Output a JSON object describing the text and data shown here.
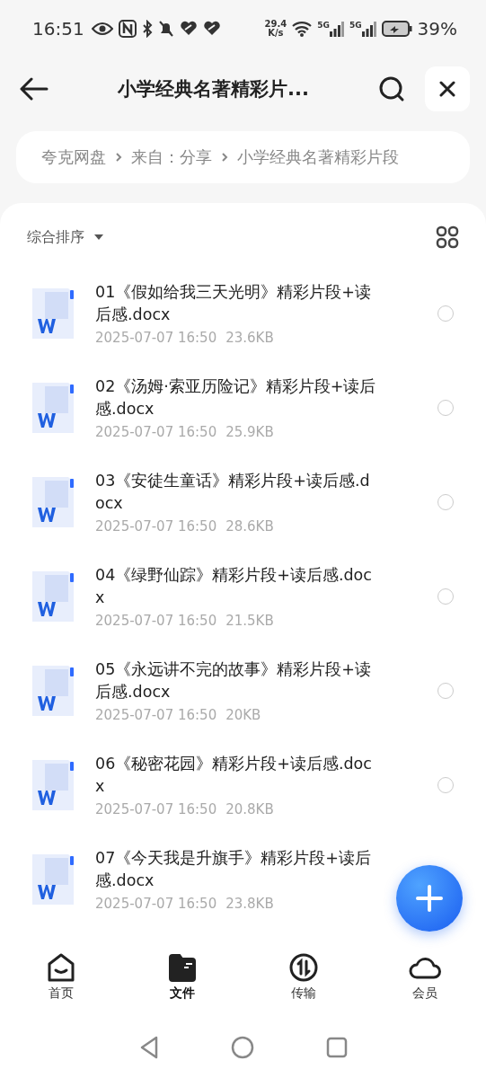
{
  "status_bar": {
    "time": "16:51",
    "net_speed_value": "29.4",
    "net_speed_unit": "K/s",
    "signal_1": "5G",
    "signal_2": "5G",
    "battery": "39%"
  },
  "header": {
    "title": "小学经典名著精彩片..."
  },
  "breadcrumb": [
    "夸克网盘",
    "来自：分享",
    "小学经典名著精彩片段"
  ],
  "sort": {
    "label": "综合排序"
  },
  "files": [
    {
      "name": "01《假如给我三天光明》精彩片段+读后感.docx",
      "date": "2025-07-07 16:50",
      "size": "23.6KB",
      "selected": false
    },
    {
      "name": "02《汤姆·索亚历险记》精彩片段+读后感.docx",
      "date": "2025-07-07 16:50",
      "size": "25.9KB",
      "selected": false
    },
    {
      "name": "03《安徒生童话》精彩片段+读后感.docx",
      "date": "2025-07-07 16:50",
      "size": "28.6KB",
      "selected": false
    },
    {
      "name": "04《绿野仙踪》精彩片段+读后感.docx",
      "date": "2025-07-07 16:50",
      "size": "21.5KB",
      "selected": false
    },
    {
      "name": "05《永远讲不完的故事》精彩片段+读后感.docx",
      "date": "2025-07-07 16:50",
      "size": "20KB",
      "selected": false
    },
    {
      "name": "06《秘密花园》精彩片段+读后感.docx",
      "date": "2025-07-07 16:50",
      "size": "20.8KB",
      "selected": false
    },
    {
      "name": "07《今天我是升旗手》精彩片段+读后感.docx",
      "date": "2025-07-07 16:50",
      "size": "23.8KB"
    }
  ],
  "bottom_nav": [
    {
      "label": "首页",
      "kind": "home",
      "selected": false
    },
    {
      "label": "文件",
      "kind": "files",
      "selected": true
    },
    {
      "label": "传输",
      "kind": "transfer",
      "selected": false
    },
    {
      "label": "会员",
      "kind": "cloud",
      "selected": false
    }
  ]
}
